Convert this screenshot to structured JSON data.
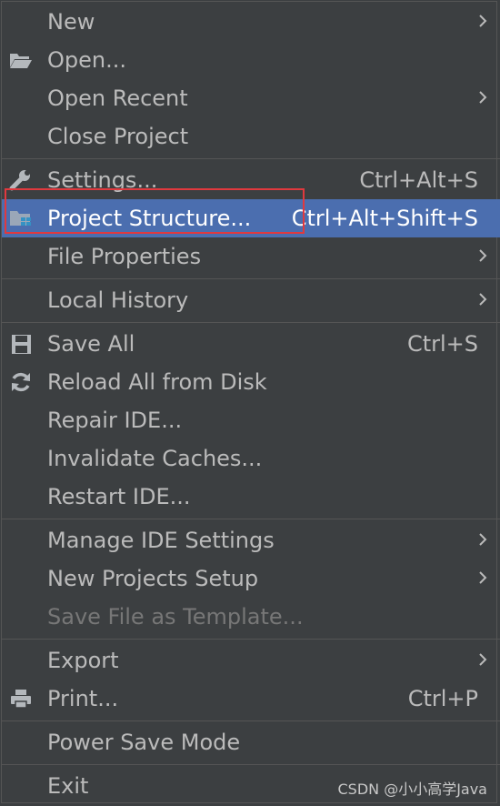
{
  "menu": {
    "items": [
      {
        "label": "New",
        "shortcut": "",
        "submenu": true
      },
      {
        "label": "Open...",
        "shortcut": "",
        "icon": "folder-open-icon"
      },
      {
        "label": "Open Recent",
        "shortcut": "",
        "submenu": true
      },
      {
        "label": "Close Project",
        "shortcut": ""
      },
      {
        "label": "Settings...",
        "shortcut": "Ctrl+Alt+S",
        "icon": "wrench-icon"
      },
      {
        "label": "Project Structure...",
        "shortcut": "Ctrl+Alt+Shift+S",
        "icon": "project-structure-icon",
        "selected": true
      },
      {
        "label": "File Properties",
        "shortcut": "",
        "submenu": true
      },
      {
        "label": "Local History",
        "shortcut": "",
        "submenu": true
      },
      {
        "label": "Save All",
        "shortcut": "Ctrl+S",
        "icon": "save-icon"
      },
      {
        "label": "Reload All from Disk",
        "shortcut": "",
        "icon": "reload-icon"
      },
      {
        "label": "Repair IDE...",
        "shortcut": ""
      },
      {
        "label": "Invalidate Caches...",
        "shortcut": ""
      },
      {
        "label": "Restart IDE...",
        "shortcut": ""
      },
      {
        "label": "Manage IDE Settings",
        "shortcut": "",
        "submenu": true
      },
      {
        "label": "New Projects Setup",
        "shortcut": "",
        "submenu": true
      },
      {
        "label": "Save File as Template...",
        "shortcut": "",
        "disabled": true
      },
      {
        "label": "Export",
        "shortcut": "",
        "submenu": true
      },
      {
        "label": "Print...",
        "shortcut": "Ctrl+P",
        "icon": "printer-icon"
      },
      {
        "label": "Power Save Mode",
        "shortcut": ""
      },
      {
        "label": "Exit",
        "shortcut": ""
      }
    ]
  },
  "colors": {
    "background": "#3c3f41",
    "selection": "#4b6eaf",
    "text": "#bbbbbb",
    "disabled_text": "#777777",
    "highlight_box": "#e0393e"
  },
  "watermark": "CSDN @小小高学Java"
}
